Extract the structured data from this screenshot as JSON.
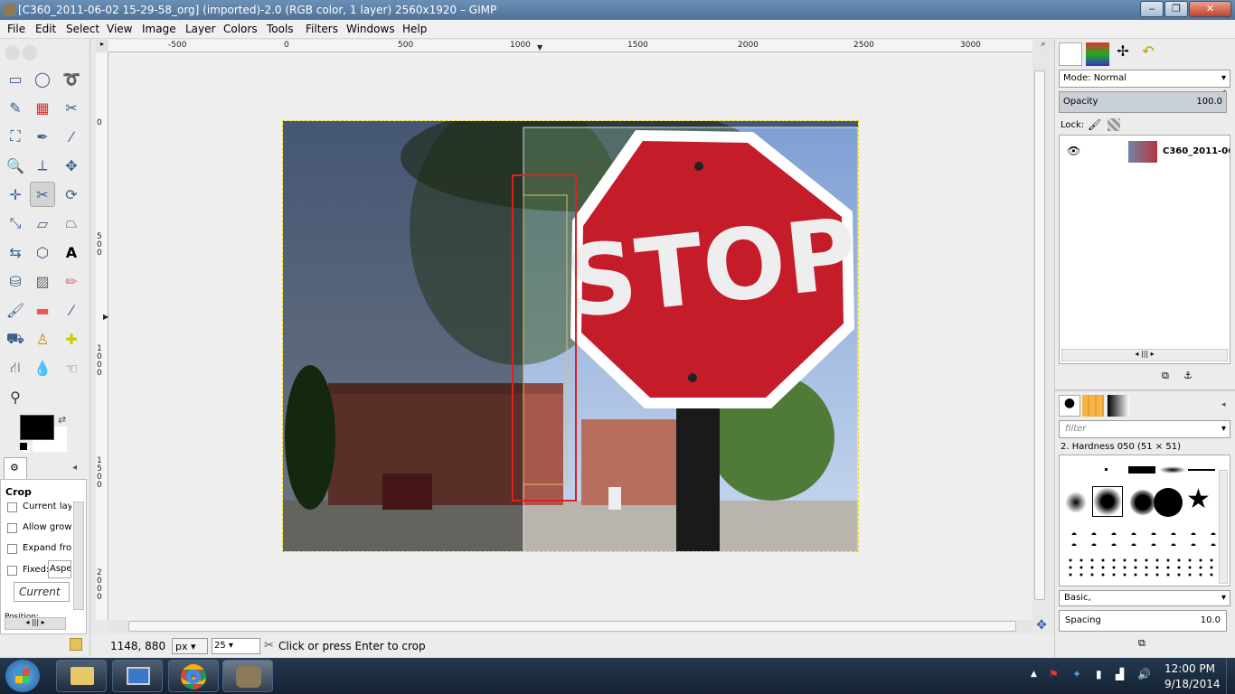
{
  "window": {
    "title": "[C360_2011-06-02 15-29-58_org] (imported)-2.0 (RGB color, 1 layer) 2560x1920 – GIMP",
    "minimize": "‒",
    "maximize": "❐",
    "close": "✕"
  },
  "menu": [
    {
      "label": "File"
    },
    {
      "label": "Edit"
    },
    {
      "label": "Select"
    },
    {
      "label": "View"
    },
    {
      "label": "Image"
    },
    {
      "label": "Layer"
    },
    {
      "label": "Colors"
    },
    {
      "label": "Tools"
    },
    {
      "label": "Filters"
    },
    {
      "label": "Windows"
    },
    {
      "label": "Help"
    }
  ],
  "ruler": {
    "h_ticks": [
      "-500",
      "0",
      "500",
      "1000",
      "1500",
      "2000",
      "2500",
      "3000"
    ],
    "v_ticks": [
      "0",
      "5\n0\n0",
      "1\n0\n0\n0",
      "1\n5\n0\n0",
      "2\n0\n0\n0"
    ]
  },
  "tool_options": {
    "title": "Crop",
    "current_layer": "Current laye",
    "allow_growing": "Allow growi",
    "expand_from": "Expand fror",
    "fixed": "Fixed:",
    "fixed_value": "Aspe",
    "current_field": "Current",
    "position": "Position:"
  },
  "status": {
    "coords": "1148, 880",
    "unit": "px",
    "zoom": "25",
    "message": "Click or press Enter to crop"
  },
  "layers": {
    "mode_label": "Mode: Normal",
    "opacity_label": "Opacity",
    "opacity_value": "100.0",
    "lock_label": "Lock:",
    "layer_name": "C360_2011-06-("
  },
  "brushes": {
    "filter_placeholder": "filter",
    "brush_name": "2. Hardness 050 (51 × 51)",
    "preset": "Basic,",
    "spacing_label": "Spacing",
    "spacing_value": "10.0"
  },
  "image": {
    "sign_text": "STOP"
  },
  "taskbar": {
    "time": "12:00 PM",
    "date": "9/18/2014"
  }
}
